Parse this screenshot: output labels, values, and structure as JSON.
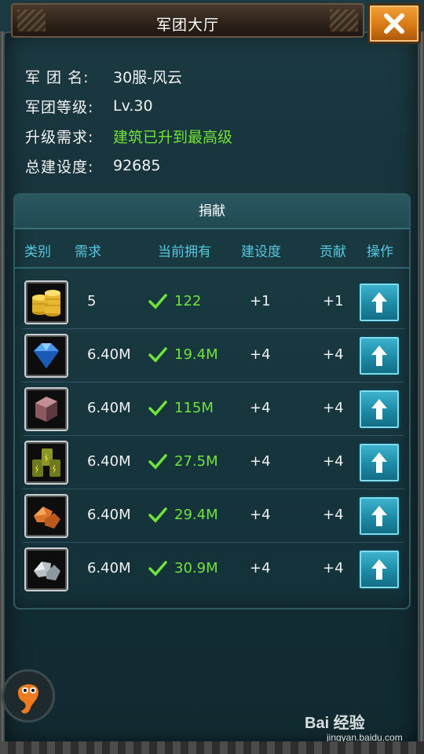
{
  "header": {
    "title": "军团大厅"
  },
  "info": {
    "name_label": "军 团 名:",
    "name_value": "30服-风云",
    "level_label": "军团等级:",
    "level_value": "Lv.30",
    "upgrade_label": "升级需求:",
    "upgrade_value": "建筑已升到最高级",
    "build_label": "总建设度:",
    "build_value": "92685"
  },
  "donate": {
    "title": "捐献",
    "columns": [
      "类别",
      "需求",
      "当前拥有",
      "建设度",
      "贡献",
      "操作"
    ],
    "rows": [
      {
        "icon": "gold-coins-icon",
        "need": "5",
        "have": "122",
        "build": "+1",
        "contrib": "+1"
      },
      {
        "icon": "crystal-icon",
        "need": "6.40M",
        "have": "19.4M",
        "build": "+4",
        "contrib": "+4"
      },
      {
        "icon": "stone-icon",
        "need": "6.40M",
        "have": "115M",
        "build": "+4",
        "contrib": "+4"
      },
      {
        "icon": "fuel-barrels-icon",
        "need": "6.40M",
        "have": "27.5M",
        "build": "+4",
        "contrib": "+4"
      },
      {
        "icon": "copper-ore-icon",
        "need": "6.40M",
        "have": "29.4M",
        "build": "+4",
        "contrib": "+4"
      },
      {
        "icon": "silver-ore-icon",
        "need": "6.40M",
        "have": "30.9M",
        "build": "+4",
        "contrib": "+4"
      }
    ]
  },
  "watermark": {
    "logo": "Bai 经验",
    "sub": "jingyan.baidu.com"
  },
  "colors": {
    "accent_green": "#6fe33a",
    "header_cyan": "#56c8e0",
    "close_orange": "#e88a1f"
  }
}
